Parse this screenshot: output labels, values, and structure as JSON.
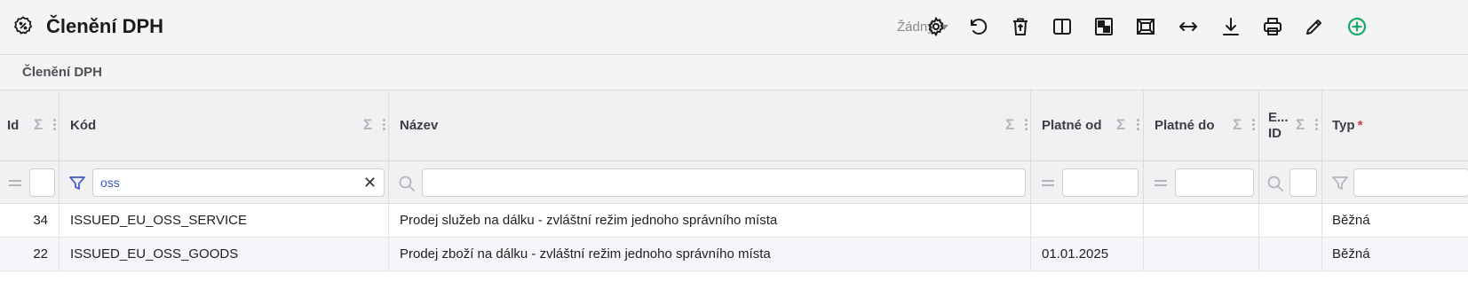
{
  "header": {
    "title": "Členění DPH",
    "variant": "Žádný"
  },
  "section": {
    "title": "Členění DPH"
  },
  "columns": [
    {
      "label": "Id"
    },
    {
      "label": "Kód"
    },
    {
      "label": "Název"
    },
    {
      "label": "Platné od"
    },
    {
      "label": "Platné do"
    },
    {
      "label_line1": "E...",
      "label_line2": "ID"
    },
    {
      "label": "Typ",
      "required": "*"
    }
  ],
  "filters": {
    "kod_value": "oss"
  },
  "rows": [
    {
      "id": "34",
      "kod": "ISSUED_EU_OSS_SERVICE",
      "nazev": "Prodej služeb na dálku - zvláštní režim jednoho správního místa",
      "platne_od": "",
      "platne_do": "",
      "e_id": "",
      "typ": "Běžná"
    },
    {
      "id": "22",
      "kod": "ISSUED_EU_OSS_GOODS",
      "nazev": "Prodej zboží na dálku - zvláštní režim jednoho správního místa",
      "platne_od": "01.01.2025",
      "platne_do": "",
      "e_id": "",
      "typ": "Běžná"
    }
  ],
  "colors": {
    "accent_add": "#1aa86a",
    "filter_active": "#3b55c8",
    "required": "#d9363e"
  }
}
